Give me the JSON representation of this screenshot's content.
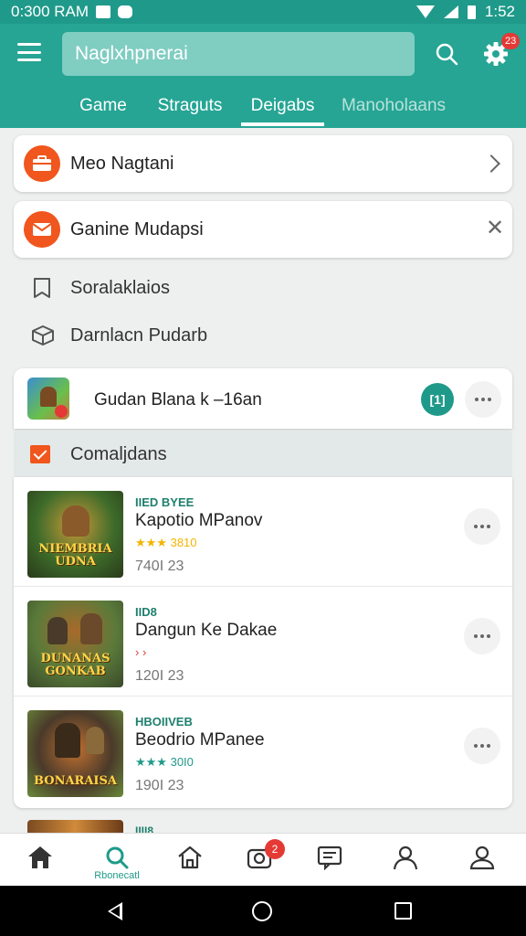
{
  "status_bar": {
    "time_left": "0:300 RAM",
    "time_right": "1:52"
  },
  "app_bar": {
    "search_text": "Naglxhpnerai",
    "notification_count": "23"
  },
  "tabs": [
    {
      "label": "Game"
    },
    {
      "label": "Straguts"
    },
    {
      "label": "Deigabs",
      "active": true
    },
    {
      "label": "Manoholaans"
    }
  ],
  "cards": {
    "first": {
      "label": "Meo Nagtani",
      "icon": "briefcase-icon"
    },
    "second": {
      "label": "Ganine Mudapsi",
      "icon": "mail-icon"
    }
  },
  "plain_rows": [
    {
      "label": "Soralaklaios",
      "icon": "bookmark-icon"
    },
    {
      "label": "Darnlacn Pudarb",
      "icon": "box-icon"
    }
  ],
  "featured": {
    "name": "Gudan Blana k –16an",
    "badge": "[1]"
  },
  "section": {
    "label": "Comaljdans"
  },
  "games": [
    {
      "tag": "IIED BYEE",
      "name": "Kapotio MPanov",
      "rating_stars": "★★★",
      "rating_value": "3810",
      "rating_color": "yellow",
      "size": "740I 23",
      "thumb_title": "NIEMBRIA UDNA",
      "thumb_colors": [
        "#3d6b2a",
        "#c99a38",
        "#2a3a1a"
      ]
    },
    {
      "tag": "IID8",
      "name": "Dangun Ke Dakae",
      "rating_stars": "›  ›",
      "rating_value": "",
      "rating_color": "red",
      "size": "120I 23",
      "thumb_title": "DUNANAS GONKAB",
      "thumb_colors": [
        "#5a7a3a",
        "#a86a2a",
        "#3a4a2a"
      ]
    },
    {
      "tag": "HBOIIVEB",
      "name": "Beodrio MPanee",
      "rating_stars": "★★★",
      "rating_value": "30I0",
      "rating_color": "green",
      "size": "190I 23",
      "thumb_title": "BONARAISA",
      "thumb_colors": [
        "#4a3a2a",
        "#c07030",
        "#6a8a3a"
      ]
    }
  ],
  "peek": {
    "tag": "IIII8"
  },
  "bottom_nav": [
    {
      "icon": "home-icon"
    },
    {
      "icon": "search-icon",
      "label": "Rbonecatl"
    },
    {
      "icon": "house-icon"
    },
    {
      "icon": "camera-icon",
      "badge": "2"
    },
    {
      "icon": "list-icon"
    },
    {
      "icon": "person-icon"
    },
    {
      "icon": "profile-icon"
    }
  ],
  "colors": {
    "accent": "#26a594",
    "orange": "#f0561d",
    "badge_red": "#e53935"
  }
}
